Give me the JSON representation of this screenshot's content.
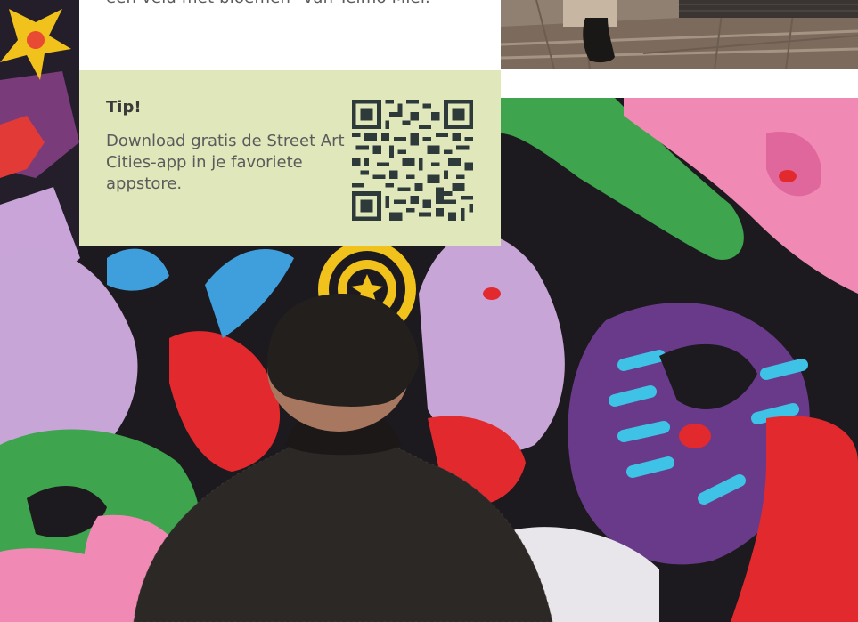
{
  "intro": {
    "text": "een veld met bloemen” van Telmo Miel."
  },
  "tip": {
    "title": "Tip!",
    "body": "Download gratis de Street Art Cities-app in je favoriete appstore.",
    "qr_label": "QR-code"
  },
  "colors": {
    "tip_background": "#dfe7bb",
    "body_text": "#5b5b5b",
    "mural_background": "#1c1a1e"
  }
}
